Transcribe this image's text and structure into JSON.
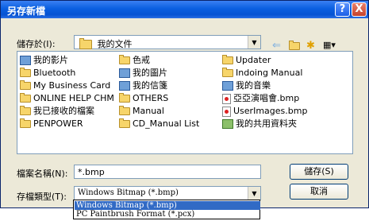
{
  "window": {
    "title": "另存新檔",
    "help_glyph": "?",
    "close_glyph": "X"
  },
  "save_in": {
    "label": "儲存於(I):",
    "value": "我的文件"
  },
  "toolbar": {
    "back_icon": "back-arrow-icon",
    "up_icon": "up-folder-icon",
    "new_folder_icon": "new-folder-icon",
    "views_icon": "views-menu-icon"
  },
  "files": [
    {
      "name": "我的影片",
      "icon": "folder-video-icon"
    },
    {
      "name": "Bluetooth",
      "icon": "folder-icon"
    },
    {
      "name": "My Business Card",
      "icon": "folder-icon"
    },
    {
      "name": "ONLINE HELP CHM",
      "icon": "folder-icon"
    },
    {
      "name": "我已接收的檔案",
      "icon": "folder-icon"
    },
    {
      "name": "PENPOWER",
      "icon": "folder-icon"
    },
    {
      "name": "色戒",
      "icon": "folder-icon"
    },
    {
      "name": "我的圖片",
      "icon": "folder-pictures-icon"
    },
    {
      "name": "我的信箋",
      "icon": "folder-letter-icon"
    },
    {
      "name": "OTHERS",
      "icon": "folder-icon"
    },
    {
      "name": "Manual",
      "icon": "folder-icon"
    },
    {
      "name": "CD_Manual List",
      "icon": "folder-icon"
    },
    {
      "name": "Updater",
      "icon": "folder-icon"
    },
    {
      "name": "Indoing Manual",
      "icon": "folder-icon"
    },
    {
      "name": "我的音樂",
      "icon": "folder-music-icon"
    },
    {
      "name": "亞亞演唱會.bmp",
      "icon": "bmp-file-icon"
    },
    {
      "name": "UserImages.bmp",
      "icon": "bmp-file-icon"
    },
    {
      "name": "我的共用資料夾",
      "icon": "shared-folder-icon"
    }
  ],
  "filename": {
    "label": "檔案名稱(N):",
    "value": "*.bmp"
  },
  "filetype": {
    "label": "存檔類型(T):",
    "value": "Windows Bitmap (*.bmp)",
    "options": [
      "Windows Bitmap (*.bmp)",
      "PC Paintbrush Format (*.pcx)"
    ]
  },
  "buttons": {
    "save": "儲存(S)",
    "cancel": "取消"
  }
}
